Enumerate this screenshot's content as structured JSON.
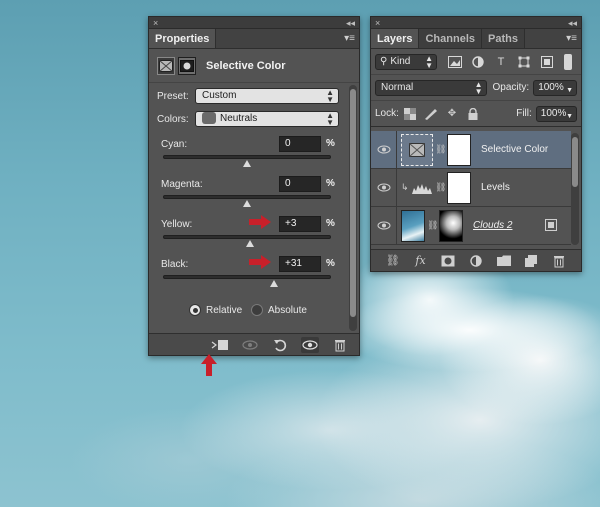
{
  "properties_panel": {
    "topbar": {
      "close": "×",
      "collapse": "◂◂"
    },
    "tab_label": "Properties",
    "menu": "▾≡",
    "title": "Selective Color",
    "preset_label": "Preset:",
    "preset_value": "Custom",
    "colors_label": "Colors:",
    "colors_value": "Neutrals",
    "sliders": [
      {
        "label": "Cyan:",
        "value": "0",
        "unit": "%",
        "position": 0.5
      },
      {
        "label": "Magenta:",
        "value": "0",
        "unit": "%",
        "position": 0.5
      },
      {
        "label": "Yellow:",
        "value": "+3",
        "unit": "%",
        "position": 0.52
      },
      {
        "label": "Black:",
        "value": "+31",
        "unit": "%",
        "position": 0.66
      }
    ],
    "method_options": [
      {
        "label": "Relative",
        "selected": true
      },
      {
        "label": "Absolute",
        "selected": false
      }
    ],
    "footer_icons": [
      "clip-to-layer-icon",
      "view-previous-icon",
      "reset-icon",
      "visibility-icon",
      "trash-icon"
    ]
  },
  "layers_panel": {
    "topbar": {
      "close": "×",
      "collapse": "◂◂"
    },
    "tabs": [
      "Layers",
      "Channels",
      "Paths"
    ],
    "menu": "▾≡",
    "filter_kind": "Kind",
    "blend_mode": "Normal",
    "opacity_label": "Opacity:",
    "opacity_value": "100%",
    "lock_label": "Lock:",
    "fill_label": "Fill:",
    "fill_value": "100%",
    "layers": [
      {
        "name": "Selective Color",
        "selected": true,
        "thumbnail": "selective-color-adjustment"
      },
      {
        "name": "Levels",
        "selected": false,
        "thumbnail": "levels-adjustment"
      },
      {
        "name": "Clouds 2",
        "selected": false,
        "thumbnail": "clouds-image"
      }
    ]
  },
  "colors": {
    "panel_bg": "#535353",
    "selected_row": "#5f6e80",
    "annotation_arrow": "#c8202a"
  }
}
